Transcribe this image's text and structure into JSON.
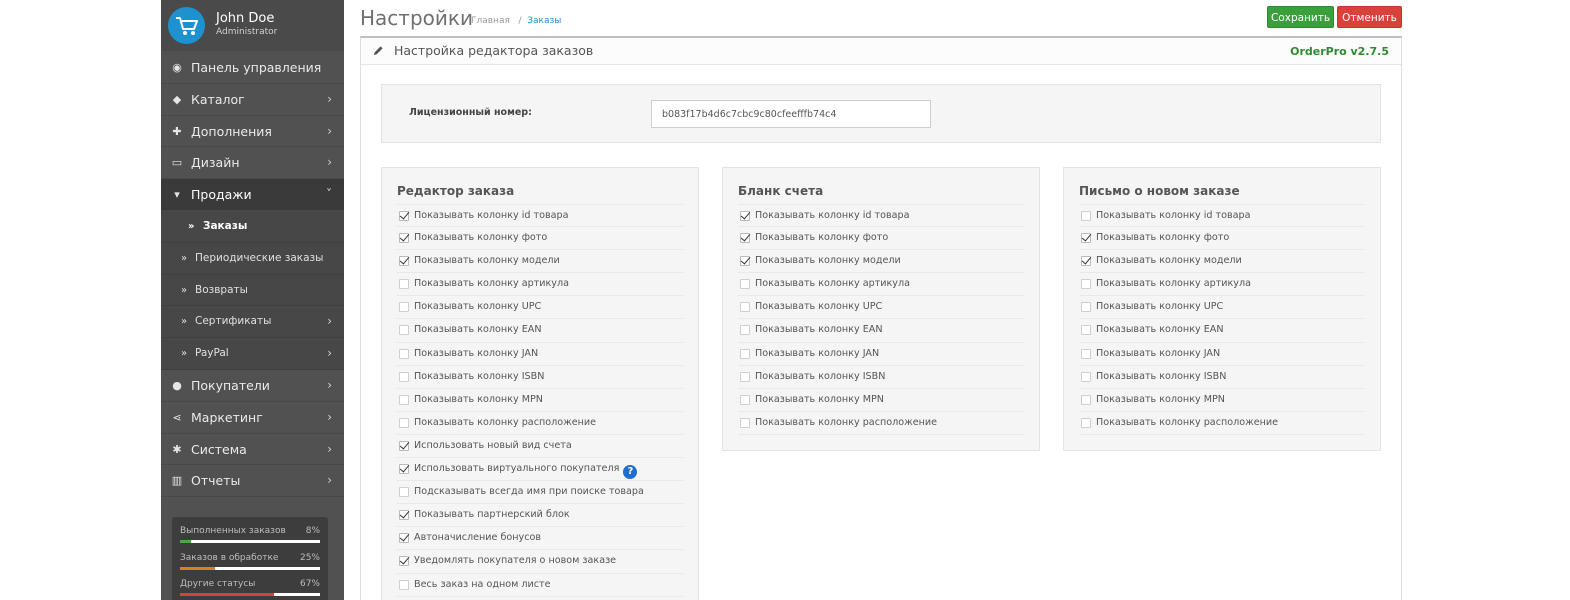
{
  "profile": {
    "name": "John Doe",
    "role": "Administrator"
  },
  "sidebar": {
    "items": [
      {
        "label": "Панель управления",
        "icon": "dashboard-icon",
        "expandable": false
      },
      {
        "label": "Каталог",
        "icon": "tags-icon",
        "expandable": true
      },
      {
        "label": "Дополнения",
        "icon": "puzzle-icon",
        "expandable": true
      },
      {
        "label": "Дизайн",
        "icon": "monitor-icon",
        "expandable": true
      },
      {
        "label": "Продажи",
        "icon": "cart-icon",
        "expandable": true,
        "open": true
      },
      {
        "label": "Покупатели",
        "icon": "user-icon",
        "expandable": true
      },
      {
        "label": "Маркетинг",
        "icon": "share-icon",
        "expandable": true
      },
      {
        "label": "Система",
        "icon": "cog-icon",
        "expandable": true
      },
      {
        "label": "Отчеты",
        "icon": "bar-chart-icon",
        "expandable": true
      }
    ],
    "sales_sub": [
      {
        "label": "Заказы",
        "active": true
      },
      {
        "label": "Периодические заказы"
      },
      {
        "label": "Возвраты"
      },
      {
        "label": "Сертификаты",
        "expandable": true
      },
      {
        "label": "PayPal",
        "expandable": true
      }
    ],
    "stats": [
      {
        "label": "Выполненных заказов",
        "value": "8%",
        "percent": 8,
        "color": "#4ca64c"
      },
      {
        "label": "Заказов в обработке",
        "value": "25%",
        "percent": 25,
        "color": "#e07c1a"
      },
      {
        "label": "Другие статусы",
        "value": "67%",
        "percent": 67,
        "color": "#d9423a"
      }
    ]
  },
  "header": {
    "title": "Настройки",
    "breadcrumb": [
      "Главная",
      "Заказы"
    ],
    "save_label": "Сохранить",
    "cancel_label": "Отменить"
  },
  "panel": {
    "title": "Настройка редактора заказов",
    "version": "OrderPro v2.7.5",
    "license_label": "Лицензионный номер:",
    "license_value": "b083f17b4d6c7cbc9c80cfeefffb74c4"
  },
  "columns": [
    {
      "title": "Редактор заказа",
      "rows": [
        {
          "label": "Показывать колонку id товара",
          "checked": true
        },
        {
          "label": "Показывать колонку фото",
          "checked": true
        },
        {
          "label": "Показывать колонку модели",
          "checked": true
        },
        {
          "label": "Показывать колонку артикула",
          "checked": false
        },
        {
          "label": "Показывать колонку UPC",
          "checked": false
        },
        {
          "label": "Показывать колонку EAN",
          "checked": false
        },
        {
          "label": "Показывать колонку JAN",
          "checked": false
        },
        {
          "label": "Показывать колонку ISBN",
          "checked": false
        },
        {
          "label": "Показывать колонку MPN",
          "checked": false
        },
        {
          "label": "Показывать колонку расположение",
          "checked": false
        },
        {
          "label": "Использовать новый вид счета",
          "checked": true
        },
        {
          "label": "Использовать виртуального покупателя",
          "checked": true,
          "help": "?"
        },
        {
          "label": "Подсказывать всегда имя при поиске товара",
          "checked": false
        },
        {
          "label": "Показывать партнерский блок",
          "checked": true
        },
        {
          "label": "Автоначисление бонусов",
          "checked": true
        },
        {
          "label": "Уведомлять покупателя о новом заказе",
          "checked": true
        },
        {
          "label": "Весь заказ на одном листе",
          "checked": false
        }
      ]
    },
    {
      "title": "Бланк счета",
      "rows": [
        {
          "label": "Показывать колонку id товара",
          "checked": true
        },
        {
          "label": "Показывать колонку фото",
          "checked": true
        },
        {
          "label": "Показывать колонку модели",
          "checked": true
        },
        {
          "label": "Показывать колонку артикула",
          "checked": false
        },
        {
          "label": "Показывать колонку UPC",
          "checked": false
        },
        {
          "label": "Показывать колонку EAN",
          "checked": false
        },
        {
          "label": "Показывать колонку JAN",
          "checked": false
        },
        {
          "label": "Показывать колонку ISBN",
          "checked": false
        },
        {
          "label": "Показывать колонку MPN",
          "checked": false
        },
        {
          "label": "Показывать колонку расположение",
          "checked": false
        }
      ]
    },
    {
      "title": "Письмо о новом заказе",
      "rows": [
        {
          "label": "Показывать колонку id товара",
          "checked": false
        },
        {
          "label": "Показывать колонку фото",
          "checked": true
        },
        {
          "label": "Показывать колонку модели",
          "checked": true
        },
        {
          "label": "Показывать колонку артикула",
          "checked": false
        },
        {
          "label": "Показывать колонку UPC",
          "checked": false
        },
        {
          "label": "Показывать колонку EAN",
          "checked": false
        },
        {
          "label": "Показывать колонку JAN",
          "checked": false
        },
        {
          "label": "Показывать колонку ISBN",
          "checked": false
        },
        {
          "label": "Показывать колонку MPN",
          "checked": false
        },
        {
          "label": "Показывать колонку расположение",
          "checked": false
        }
      ]
    }
  ]
}
